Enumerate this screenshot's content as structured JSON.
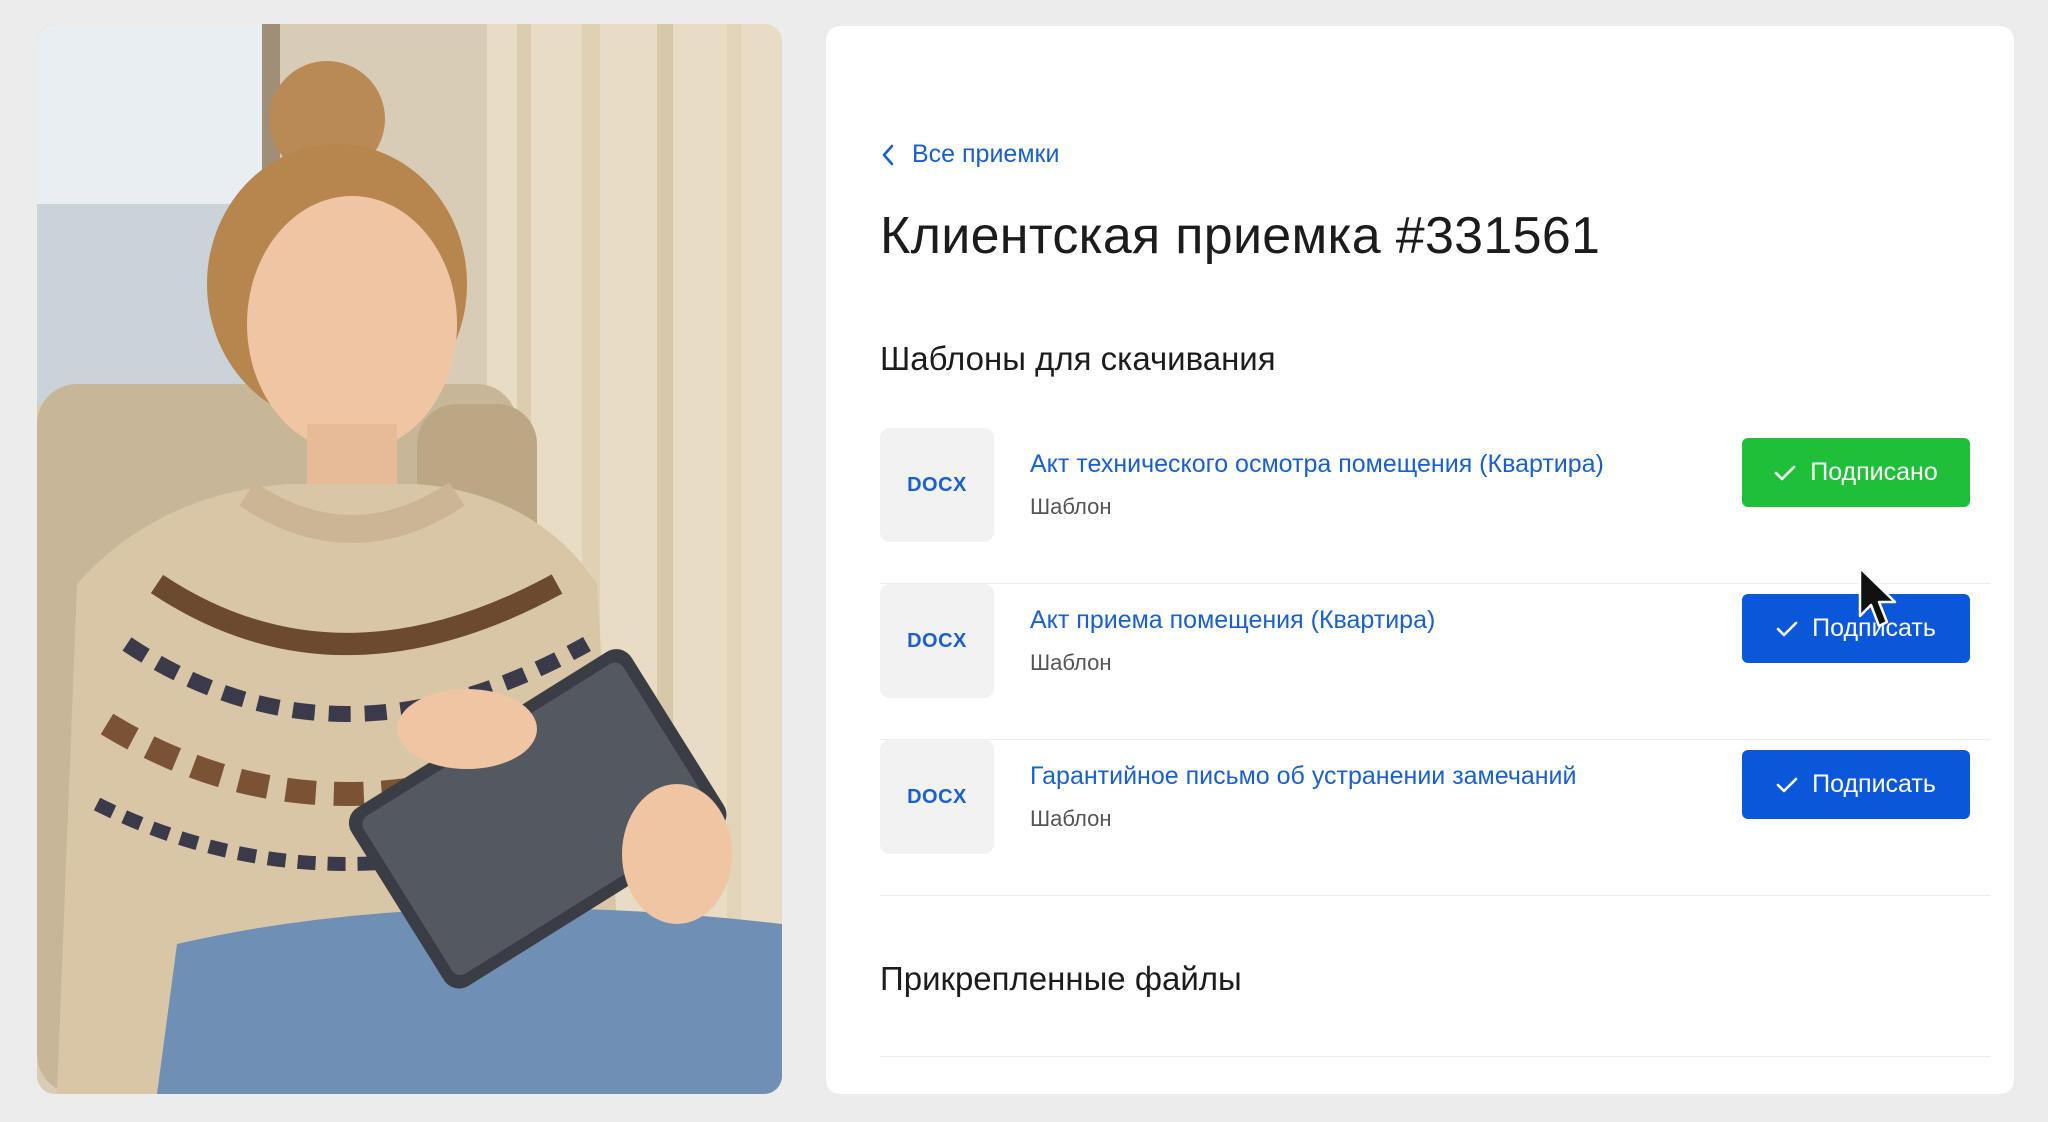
{
  "navigation": {
    "back_label": "Все приемки"
  },
  "page": {
    "title": "Клиентская приемка #331561"
  },
  "sections": {
    "templates_title": "Шаблоны для скачивания",
    "attached_title": "Прикрепленные файлы"
  },
  "documents": [
    {
      "type": "DOCX",
      "title": "Акт технического осмотра помещения (Квартира)",
      "subtitle": "Шаблон",
      "button_label": "Подписано",
      "status": "signed"
    },
    {
      "type": "DOCX",
      "title": "Акт приема помещения (Квартира)",
      "subtitle": "Шаблон",
      "button_label": "Подписать",
      "status": "unsigned"
    },
    {
      "type": "DOCX",
      "title": "Гарантийное письмо об устранении замечаний",
      "subtitle": "Шаблон",
      "button_label": "Подписать",
      "status": "unsigned"
    }
  ],
  "colors": {
    "accent": "#1a5fd0",
    "signed": "#1fbf3a",
    "sign": "#0b57d9",
    "background": "#ececec"
  },
  "icons": {
    "back": "chevron-left-icon",
    "check": "check-icon",
    "cursor": "mouse-pointer-icon"
  }
}
